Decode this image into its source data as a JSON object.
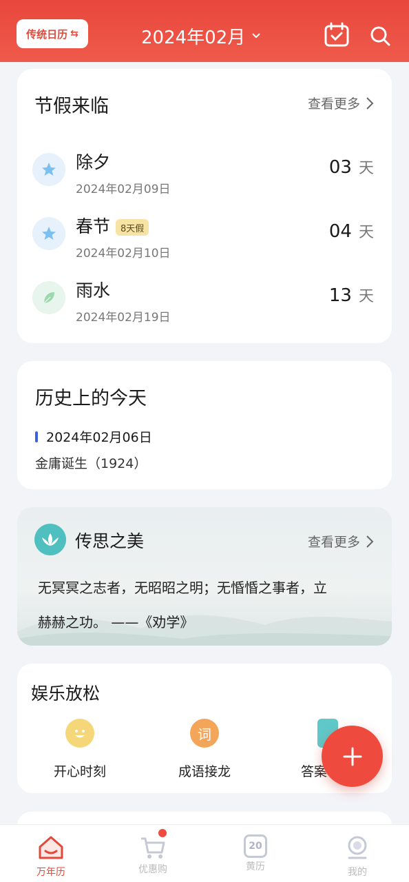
{
  "header": {
    "calendar_toggle": "传统日历",
    "calendar_toggle_icon": "swap-icon",
    "month": "2024年02月",
    "icons": [
      "calendar-check-icon",
      "search-icon"
    ],
    "bg_color": "#e8473c"
  },
  "holidays": {
    "title": "节假来临",
    "more": "查看更多",
    "unit": "天",
    "items": [
      {
        "name": "除夕",
        "date": "2024年02月09日",
        "days": "03",
        "icon": "star-icon"
      },
      {
        "name": "春节",
        "date": "2024年02月10日",
        "days": "04",
        "icon": "star-icon",
        "badge": "8天假"
      },
      {
        "name": "雨水",
        "date": "2024年02月19日",
        "days": "13",
        "icon": "leaf-icon"
      }
    ]
  },
  "history": {
    "title": "历史上的今天",
    "date": "2024年02月06日",
    "event": "金庸诞生（1924）"
  },
  "quote": {
    "title": "传思之美",
    "more": "查看更多",
    "line1": "无冥冥之志者，无昭昭之明；无惛惛之事者，立",
    "line2": "赫赫之功。 ——《劝学》"
  },
  "entertainment": {
    "title": "娱乐放松",
    "items": [
      {
        "label": "开心时刻",
        "icon": "smile-icon"
      },
      {
        "label": "成语接龙",
        "icon": "ci-icon",
        "icon_text": "词"
      },
      {
        "label": "答案",
        "icon": "book-icon"
      }
    ]
  },
  "fab": {
    "icon": "plus-icon"
  },
  "bottom_nav": {
    "items": [
      {
        "label": "万年历",
        "icon": "home-icon",
        "active": true
      },
      {
        "label": "优惠购",
        "icon": "cart-icon",
        "active": false,
        "dot": true
      },
      {
        "label": "黄历",
        "icon": "almanac-icon",
        "active": false,
        "icon_text": "20"
      },
      {
        "label": "我的",
        "icon": "profile-icon",
        "active": false
      }
    ]
  }
}
